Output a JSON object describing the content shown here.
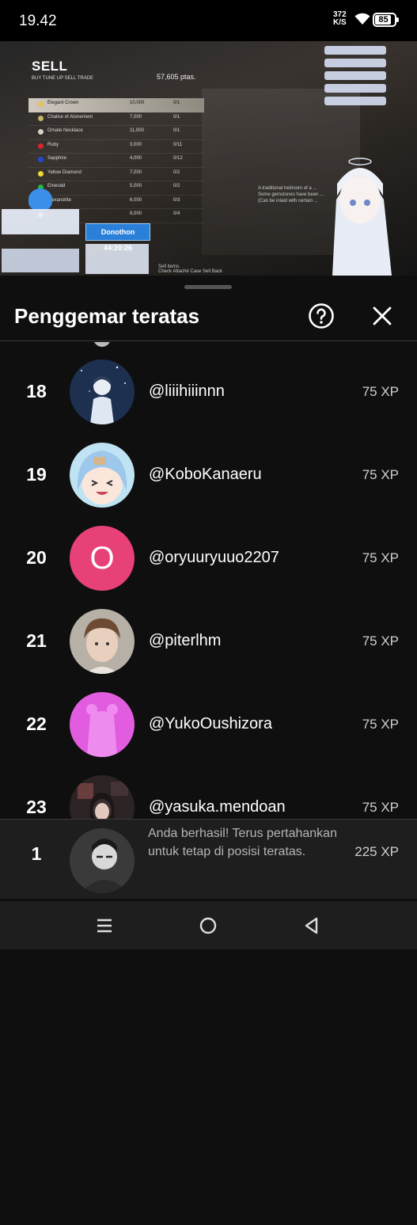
{
  "status_bar": {
    "time": "19.42",
    "net_speed_value": "372",
    "net_speed_unit": "K/S",
    "battery": "85"
  },
  "video": {
    "game_title": "SELL",
    "tabs": "BUY   TUNE UP   SELL   TRADE",
    "money": "57,605 ptas.",
    "items": [
      {
        "name": "Elegant Crown",
        "price": "10,000",
        "qty": "0/1",
        "color": "#e8c15a"
      },
      {
        "name": "Chalice of Atonement",
        "price": "7,000",
        "qty": "0/1",
        "color": "#c9b36a"
      },
      {
        "name": "Ornate Necklace",
        "price": "11,000",
        "qty": "0/1",
        "color": "#d7d2c4"
      },
      {
        "name": "Ruby",
        "price": "3,000",
        "qty": "0/11",
        "color": "#d8232a"
      },
      {
        "name": "Sapphire",
        "price": "4,000",
        "qty": "0/12",
        "color": "#2348d8"
      },
      {
        "name": "Yellow Diamond",
        "price": "7,000",
        "qty": "0/2",
        "color": "#f0d838"
      },
      {
        "name": "Emerald",
        "price": "5,000",
        "qty": "0/2",
        "color": "#24b84a"
      },
      {
        "name": "Alexandrite",
        "price": "6,000",
        "qty": "0/3",
        "color": "#8f3ad0"
      },
      {
        "name": "",
        "price": "9,000",
        "qty": "0/4",
        "color": "#cccccc"
      }
    ],
    "timer_label": "Donothon",
    "timer_value": "44:20:26",
    "desc": "A traditional heirloom of a ...\nSome gemstones have been ...\n(Can be inlaid with certain ...",
    "hint": "Sell items.",
    "bottom_hint": "Check Attaché Case   Sell   Back"
  },
  "sheet": {
    "title": "Penggemar teratas",
    "help_icon": "help-circle-icon",
    "close_icon": "close-icon"
  },
  "fans": [
    {
      "rank": "18",
      "name": "@liiihiiinnn",
      "xp": "75 XP",
      "avatar": "night-sky-boy"
    },
    {
      "rank": "19",
      "name": "@KoboKanaeru",
      "xp": "75 XP",
      "avatar": "anime-blue-hair"
    },
    {
      "rank": "20",
      "name": "@oryuuryuuo2207",
      "xp": "75 XP",
      "avatar": "letter",
      "letter": "O",
      "color": "#e84178"
    },
    {
      "rank": "21",
      "name": "@piterlhm",
      "xp": "75 XP",
      "avatar": "child-photo"
    },
    {
      "rank": "22",
      "name": "@YukoOushizora",
      "xp": "75 XP",
      "avatar": "pink-silhouette"
    },
    {
      "rank": "23",
      "name": "@yasuka.mendoan",
      "xp": "75 XP",
      "avatar": "dark-photo"
    }
  ],
  "me": {
    "rank": "1",
    "message": "Anda berhasil! Terus pertahankan untuk tetap di posisi teratas.",
    "xp": "225 XP"
  },
  "navbar": [
    "menu-icon",
    "home-icon",
    "back-icon"
  ]
}
